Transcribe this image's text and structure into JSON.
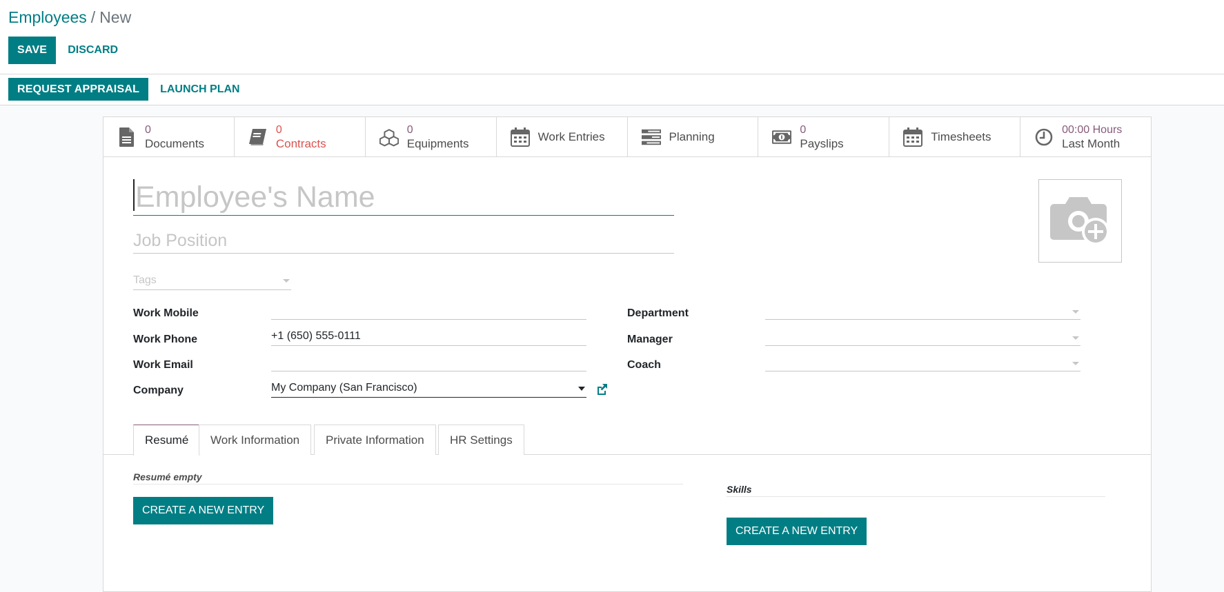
{
  "breadcrumb": {
    "parent": "Employees",
    "separator": "/",
    "current": "New"
  },
  "actions": {
    "save": "Save",
    "discard": "Discard"
  },
  "statusbar": {
    "request_appraisal": "Request Appraisal",
    "launch_plan": "Launch Plan"
  },
  "smart_buttons": [
    {
      "value": "0",
      "label": "Documents",
      "icon": "document-icon"
    },
    {
      "value": "0",
      "label": "Contracts",
      "icon": "book-icon",
      "status": "danger"
    },
    {
      "value": "0",
      "label": "Equipments",
      "icon": "cubes-icon"
    },
    {
      "value": "",
      "label": "Work Entries",
      "icon": "calendar-icon"
    },
    {
      "value": "",
      "label": "Planning",
      "icon": "tasks-icon"
    },
    {
      "value": "0",
      "label": "Payslips",
      "icon": "money-icon"
    },
    {
      "value": "",
      "label": "Timesheets",
      "icon": "calendar-icon"
    },
    {
      "value": "00:00 Hours",
      "label": "Last Month",
      "icon": "clock-icon"
    }
  ],
  "form": {
    "name_placeholder": "Employee's Name",
    "job_placeholder": "Job Position",
    "tags_placeholder": "Tags",
    "left_fields": [
      {
        "label": "Work Mobile",
        "value": ""
      },
      {
        "label": "Work Phone",
        "value": "+1 (650) 555-0111"
      },
      {
        "label": "Work Email",
        "value": ""
      },
      {
        "label": "Company",
        "value": "My Company (San Francisco)"
      }
    ],
    "right_fields": [
      {
        "label": "Department",
        "value": ""
      },
      {
        "label": "Manager",
        "value": ""
      },
      {
        "label": "Coach",
        "value": ""
      }
    ]
  },
  "tabs": [
    "Resumé",
    "Work Information",
    "Private Information",
    "HR Settings"
  ],
  "resume": {
    "empty_label": "Resumé empty",
    "create_button": "Create a new entry"
  },
  "skills": {
    "title": "Skills",
    "create_button": "Create a new entry"
  },
  "colors": {
    "primary": "#017e84",
    "accent": "#875a7b",
    "danger": "#d9534f",
    "muted": "#c6c6c6"
  }
}
